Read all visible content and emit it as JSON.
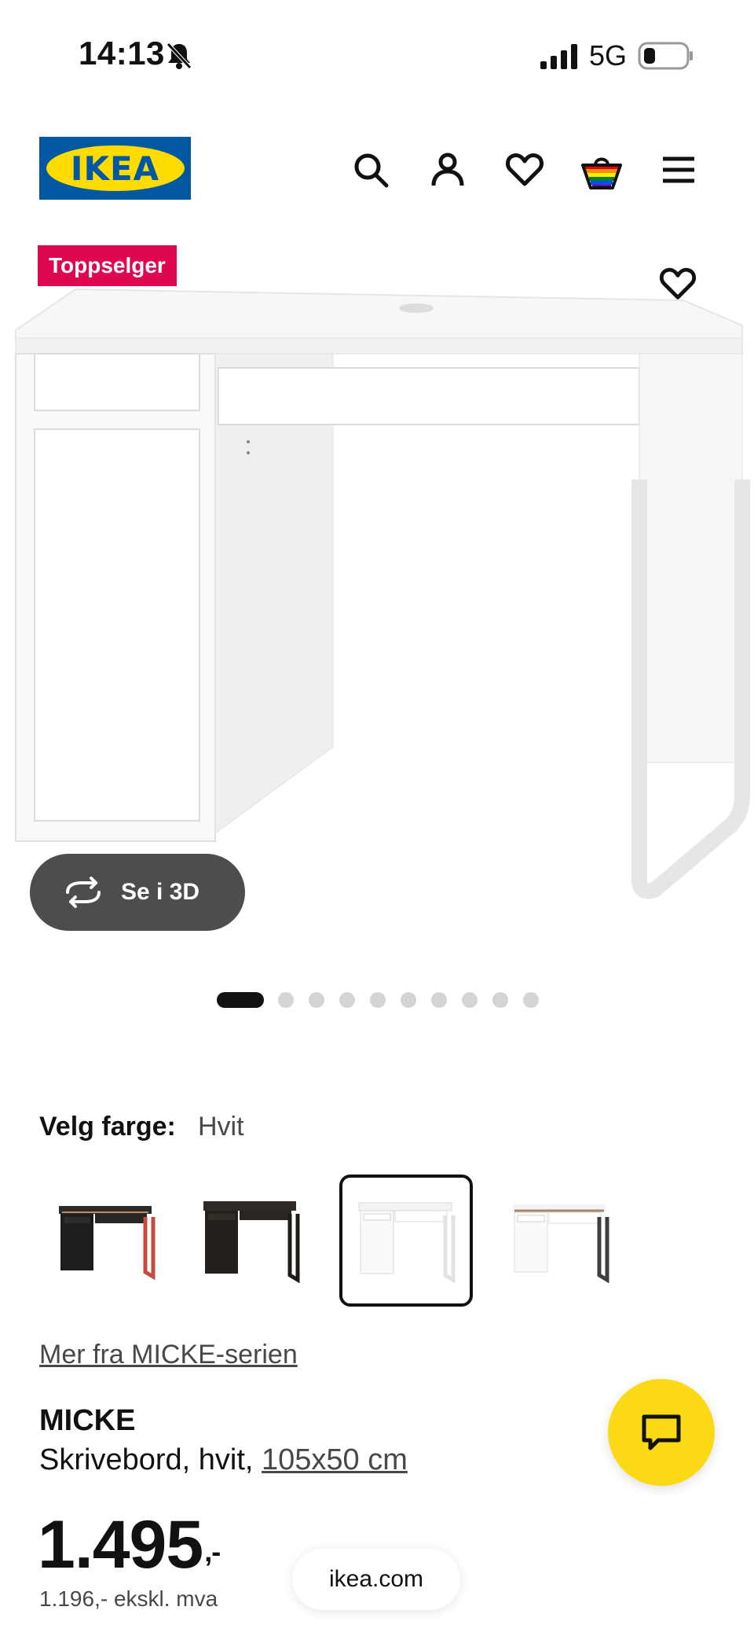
{
  "status_bar": {
    "time": "14:13",
    "network": "5G"
  },
  "header": {
    "logo_text": "IKEA",
    "icons": [
      "search-icon",
      "account-icon",
      "favorites-icon",
      "cart-icon",
      "menu-icon"
    ]
  },
  "product_image": {
    "badge": "Toppselger",
    "see_3d_label": "Se i 3D",
    "carousel_total": 10,
    "carousel_active": 1
  },
  "color_picker": {
    "label": "Velg farge:",
    "selected": "Hvit",
    "swatches": [
      {
        "name": "black-brown-red",
        "selected": false
      },
      {
        "name": "black-brown",
        "selected": false
      },
      {
        "name": "white",
        "selected": true
      },
      {
        "name": "white-anthracite",
        "selected": false
      }
    ]
  },
  "series_link": "Mer fra MICKE-serien",
  "product": {
    "name": "MICKE",
    "description_prefix": "Skrivebord, hvit,",
    "size": "105x50 cm",
    "price_main": "1.495",
    "price_suffix": ",-",
    "price_ex_vat": "1.196,- ekskl. mva"
  },
  "browser": {
    "url": "ikea.com"
  },
  "colors": {
    "badge": "#e00751",
    "chat": "#fbd914",
    "ikea_blue": "#0058a3",
    "ikea_yellow": "#ffdb00"
  }
}
